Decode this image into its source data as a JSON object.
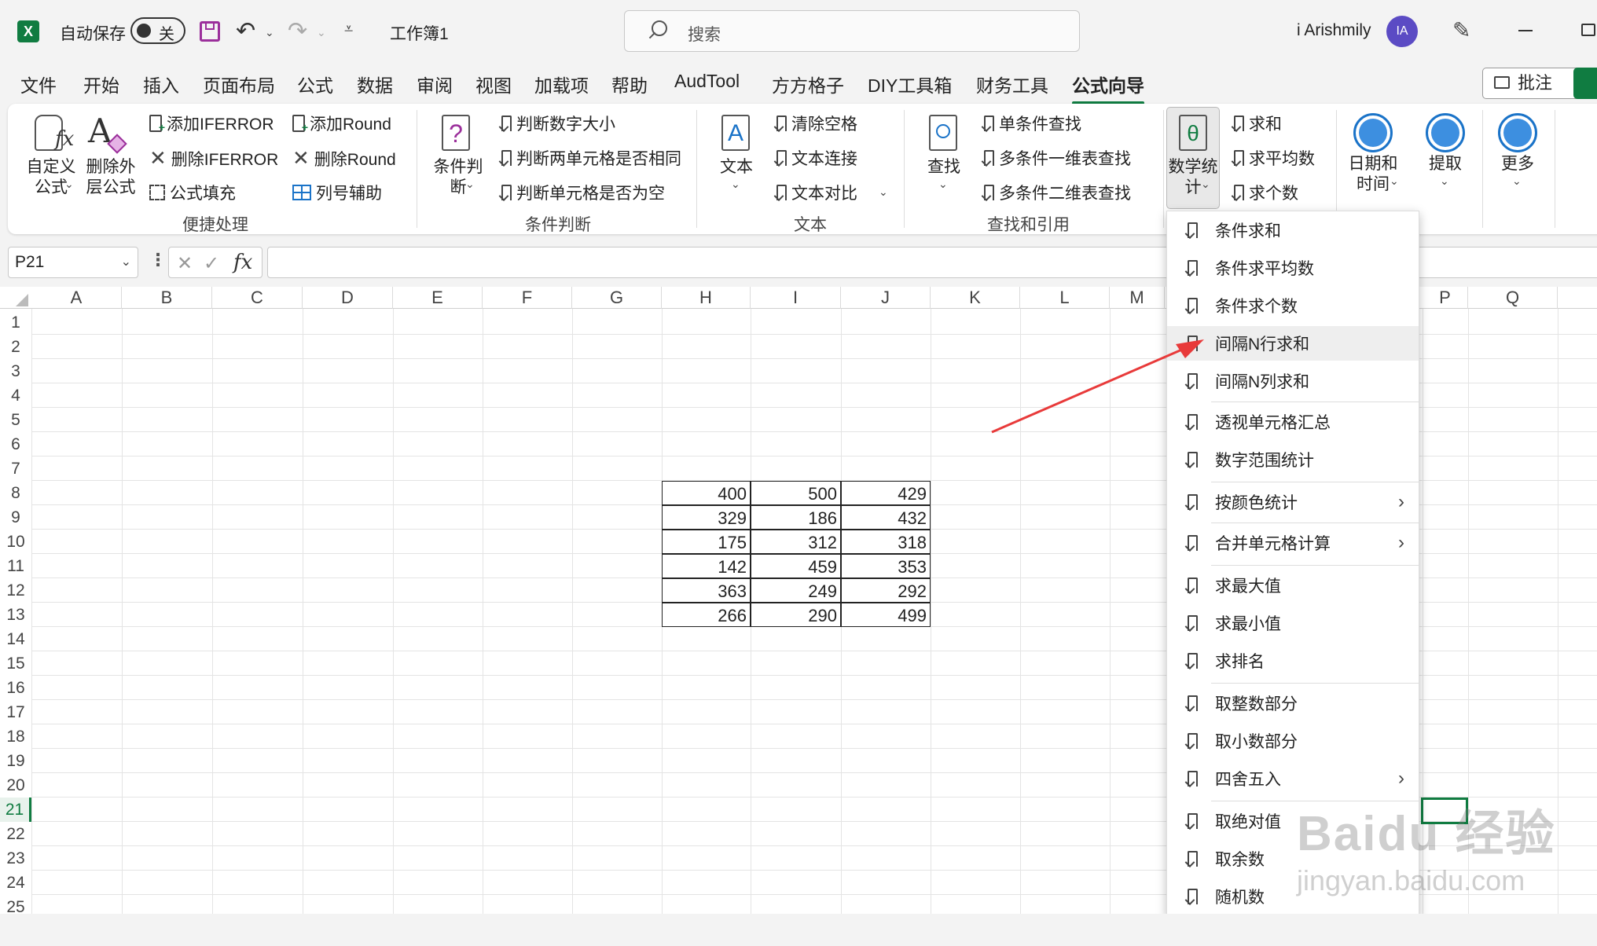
{
  "titlebar": {
    "autosave_label": "自动保存",
    "autosave_state": "关",
    "filename": "工作簿1",
    "search_placeholder": "搜索",
    "username": "i Arishmily",
    "avatar_initials": "IA"
  },
  "menu": {
    "items": [
      "文件",
      "开始",
      "插入",
      "页面布局",
      "公式",
      "数据",
      "审阅",
      "视图",
      "加载项",
      "帮助",
      "AudTool",
      "方方格子",
      "DIY工具箱",
      "财务工具",
      "公式向导"
    ],
    "active": "公式向导",
    "comment_button": "批注"
  },
  "ribbon": {
    "custom_formula": "自定义\n公式",
    "delete_outer": "删除外\n层公式",
    "add_iferror": "添加IFERROR",
    "del_iferror": "删除IFERROR",
    "formula_fill": "公式填充",
    "add_round": "添加Round",
    "del_round": "删除Round",
    "col_helper": "列号辅助",
    "group_quick": "便捷处理",
    "cond_judge": "条件判\n断",
    "judge_size": "判断数字大小",
    "judge_same": "判断两单元格是否相同",
    "judge_empty": "判断单元格是否为空",
    "group_cond": "条件判断",
    "text_btn": "文本",
    "clear_space": "清除空格",
    "text_concat": "文本连接",
    "text_compare": "文本对比",
    "group_text": "文本",
    "find_btn": "查找",
    "single_lookup": "单条件查找",
    "multi_1d": "多条件一维表查找",
    "multi_2d": "多条件二维表查找",
    "group_find": "查找和引用",
    "math_stat": "数学统\n计",
    "sum": "求和",
    "average": "求平均数",
    "count": "求个数",
    "datetime": "日期和\n时间",
    "extract": "提取",
    "more": "更多"
  },
  "formula_bar": {
    "name_box": "P21",
    "fx": "fx",
    "content": ""
  },
  "sheet": {
    "columns": [
      "A",
      "B",
      "C",
      "D",
      "E",
      "F",
      "G",
      "H",
      "I",
      "J",
      "K",
      "L",
      "M",
      "P",
      "Q"
    ],
    "rows": [
      "1",
      "2",
      "3",
      "4",
      "5",
      "6",
      "7",
      "8",
      "9",
      "10",
      "11",
      "12",
      "13",
      "14",
      "15",
      "16",
      "17",
      "18",
      "19",
      "20",
      "21",
      "22",
      "23",
      "24",
      "25"
    ],
    "active_row": "21",
    "table": [
      [
        "400",
        "500",
        "429"
      ],
      [
        "329",
        "186",
        "432"
      ],
      [
        "175",
        "312",
        "318"
      ],
      [
        "142",
        "459",
        "353"
      ],
      [
        "363",
        "249",
        "292"
      ],
      [
        "266",
        "290",
        "499"
      ]
    ]
  },
  "dropdown": {
    "items": [
      "条件求和",
      "条件求平均数",
      "条件求个数",
      "间隔N行求和",
      "间隔N列求和",
      "透视单元格汇总",
      "数字范围统计",
      "按颜色统计",
      "合并单元格计算",
      "求最大值",
      "求最小值",
      "求排名",
      "取整数部分",
      "取小数部分",
      "四舍五入",
      "取绝对值",
      "取余数",
      "随机数"
    ],
    "highlighted": "间隔N行求和"
  },
  "watermark": {
    "brand": "Baidu 经验",
    "url": "jingyan.baidu.com"
  },
  "colors": {
    "excel_green": "#107c41",
    "arrow_red": "#e83a3a",
    "avatar_purple": "#5b4bc4",
    "accent_blue": "#1a73c8"
  }
}
